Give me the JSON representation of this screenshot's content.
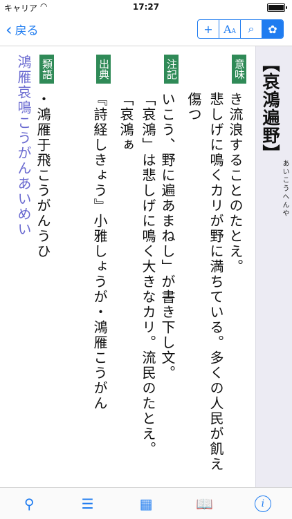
{
  "status": {
    "carrier": "キャリア",
    "time": "17:27"
  },
  "nav": {
    "back_label": "戻る",
    "tools": {
      "add": "+",
      "font_A1": "A",
      "font_A2": "A",
      "search": "⌕",
      "flower": "✿"
    }
  },
  "entry": {
    "heading": "【哀鴻遍野】",
    "reading": "あいこうへんや",
    "sections": [
      {
        "tag": "意味",
        "lines": [
          "悲しげに鳴くカリが野に満ちている。多くの人民が飢え傷つ",
          "き流浪することのたとえ。"
        ]
      },
      {
        "tag": "注記",
        "lines": [
          "「哀鴻」は悲しげに鳴く大きなカリ。流民のたとえ。「哀鴻ぁ",
          "いこう、野に遍あまねし」が書き下し文。"
        ]
      },
      {
        "tag": "出典",
        "lines": [
          "『詩経しきょう』小雅しょうが・鴻雁こうがん"
        ]
      },
      {
        "tag": "類語",
        "lines": [
          "鴻雁哀鳴こうがんあいめい",
          "・鴻雁于飛こうがんうひ"
        ]
      }
    ]
  },
  "tabs": [
    {
      "name": "search",
      "label": ""
    },
    {
      "name": "list",
      "label": ""
    },
    {
      "name": "grid",
      "label": ""
    },
    {
      "name": "book",
      "label": ""
    },
    {
      "name": "info",
      "label": "i"
    }
  ]
}
